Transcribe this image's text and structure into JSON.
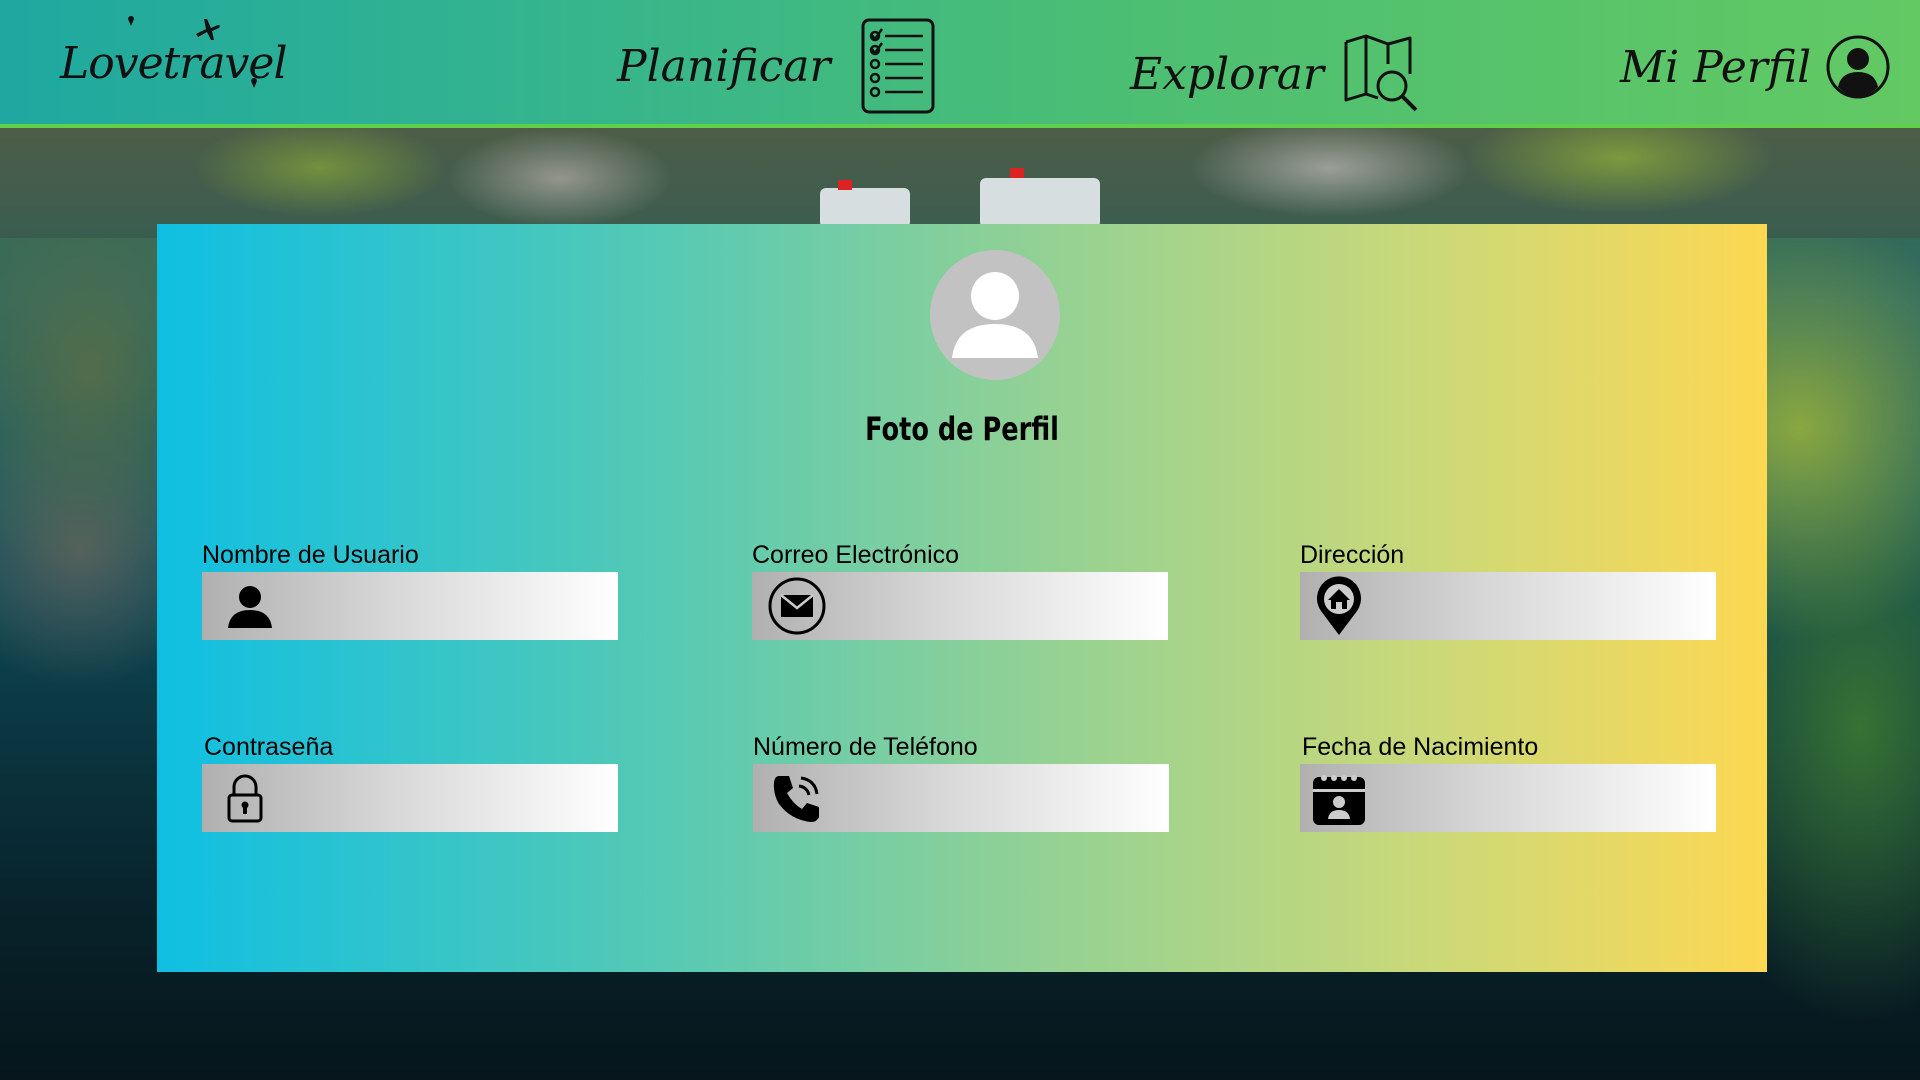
{
  "header": {
    "logo_text": "Lovetravel",
    "nav": [
      {
        "label": "Planificar",
        "icon": "checklist-icon"
      },
      {
        "label": "Explorar",
        "icon": "map-search-icon"
      },
      {
        "label": "Mi Perfil",
        "icon": "user-circle-icon"
      }
    ]
  },
  "profile": {
    "photo_title": "Foto de Perfil",
    "fields": [
      {
        "label": "Nombre de Usuario",
        "icon": "user-icon",
        "value": ""
      },
      {
        "label": "Correo Electrónico",
        "icon": "envelope-icon",
        "value": ""
      },
      {
        "label": "Dirección",
        "icon": "home-pin-icon",
        "value": ""
      },
      {
        "label": "Contraseña",
        "icon": "lock-icon",
        "value": ""
      },
      {
        "label": "Número de Teléfono",
        "icon": "phone-icon",
        "value": ""
      },
      {
        "label": "Fecha de Nacimiento",
        "icon": "calendar-user-icon",
        "value": ""
      }
    ]
  },
  "colors": {
    "header_gradient": [
      "#1ea8a0",
      "#62c963"
    ],
    "card_gradient": [
      "#0fbfe2",
      "#fdd852"
    ],
    "input_gradient": [
      "#b0b0b0",
      "#ffffff"
    ]
  }
}
